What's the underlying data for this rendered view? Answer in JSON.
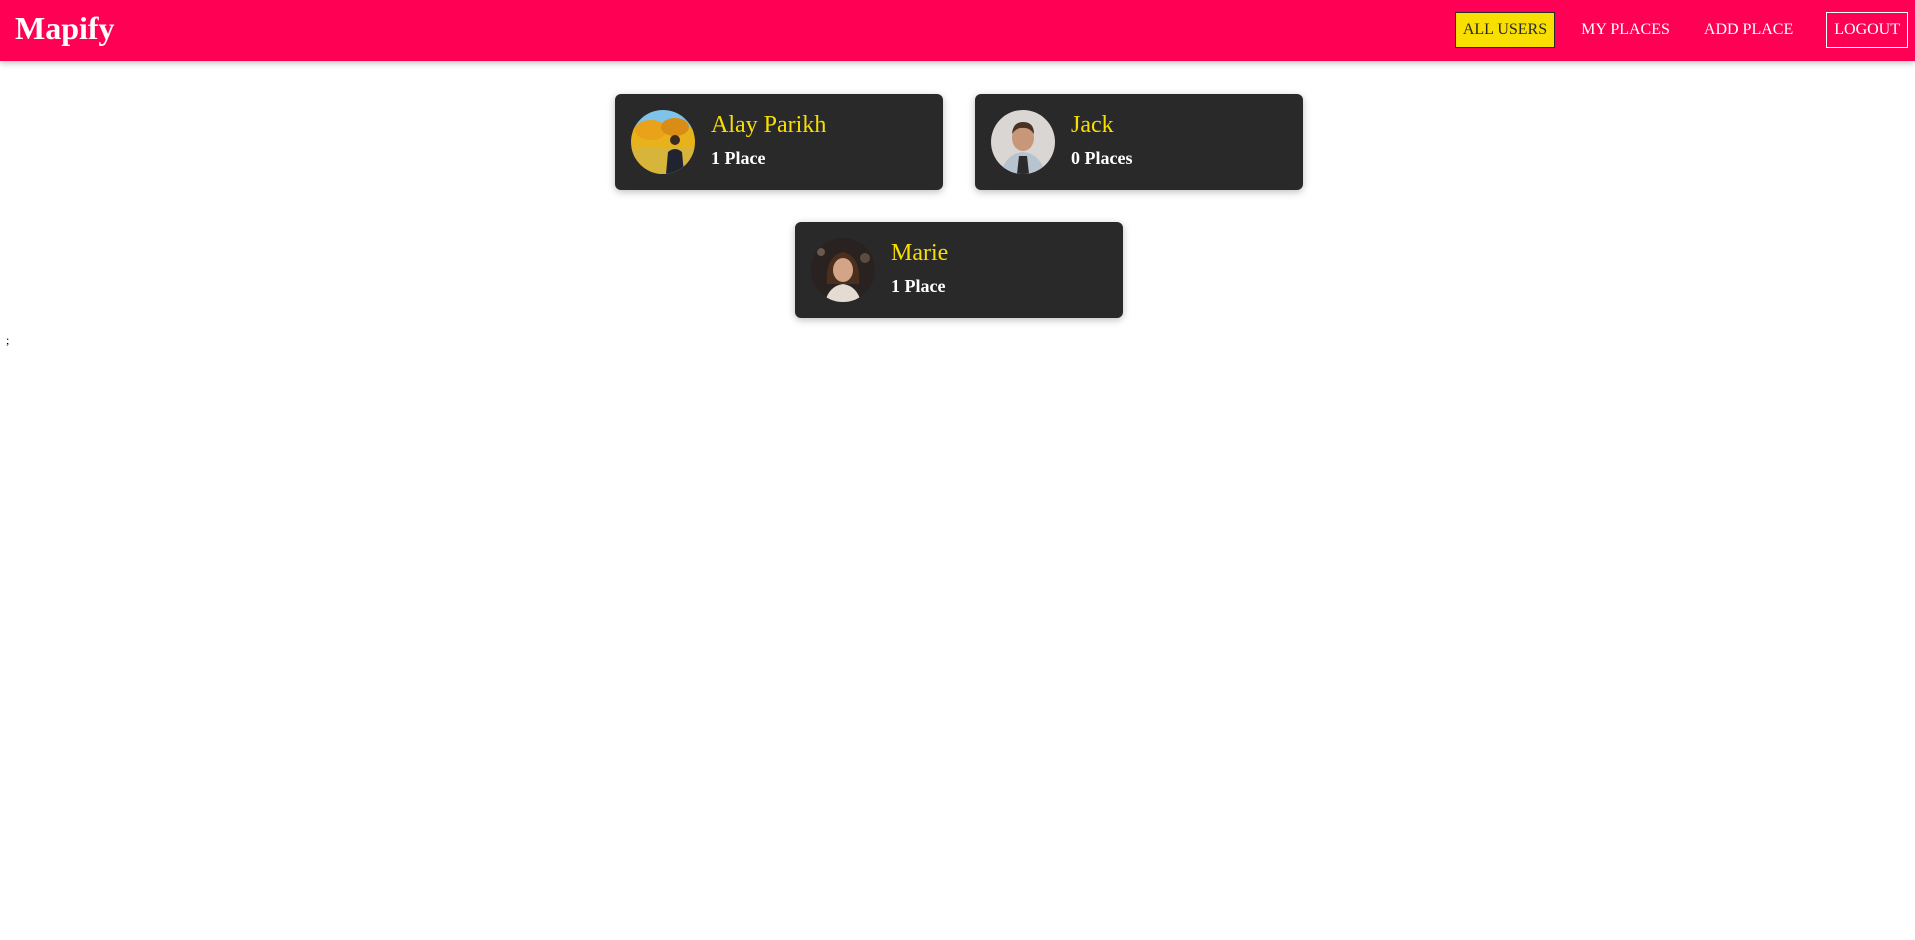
{
  "header": {
    "logo": "Mapify",
    "nav": {
      "all_users": "ALL USERS",
      "my_places": "MY PLACES",
      "add_place": "ADD PLACE",
      "logout": "LOGOUT"
    },
    "accent_color": "#ff0055",
    "active_color": "#f8df00"
  },
  "users": [
    {
      "name": "Alay Parikh",
      "places": "1 Place"
    },
    {
      "name": "Jack",
      "places": "0 Places"
    },
    {
      "name": "Marie",
      "places": "1 Place"
    }
  ],
  "stray_text": ";"
}
